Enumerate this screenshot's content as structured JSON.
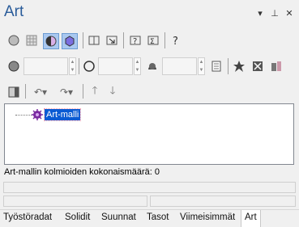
{
  "panel": {
    "title": "Art",
    "controls": {
      "dropdown": "▾",
      "pin": "⊥",
      "close": "✕"
    }
  },
  "inputs": {
    "size_value": "",
    "radius_value": "",
    "material_value": ""
  },
  "tree": {
    "root_label": "Art-malli"
  },
  "status": {
    "triangle_count_text": "Art-mallin kolmioiden kokonaismäärä: 0"
  },
  "tabs": [
    {
      "label": "Työstöradat"
    },
    {
      "label": "Solidit"
    },
    {
      "label": "Suunnat"
    },
    {
      "label": "Tasot"
    },
    {
      "label": "Viimeisimmät"
    },
    {
      "label": "Art"
    }
  ],
  "colors": {
    "title": "#2a5c9a",
    "selection": "#0a5bd3",
    "toggle_active": "#a9c8f0"
  }
}
